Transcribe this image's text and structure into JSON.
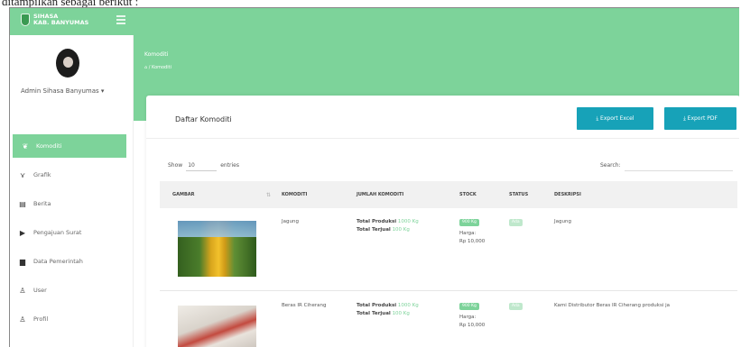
{
  "caption": {
    "text": "ditampilkan sebagai berikut :"
  },
  "brand": {
    "line1": "SIHASA",
    "line2": "KAB. BANYUMAS"
  },
  "sidebar": {
    "user_name": "Admin Sihasa Banyumas ▾",
    "items": [
      {
        "label": "Komoditi",
        "icon": "leaf-icon",
        "glyph": "❦"
      },
      {
        "label": "Grafik",
        "icon": "chart-icon",
        "glyph": "⋎"
      },
      {
        "label": "Berita",
        "icon": "news-icon",
        "glyph": "▤"
      },
      {
        "label": "Pengajuan Surat",
        "icon": "send-icon",
        "glyph": "▶"
      },
      {
        "label": "Data Pemerintah",
        "icon": "database-icon",
        "glyph": "▆"
      },
      {
        "label": "User",
        "icon": "user-icon",
        "glyph": "♙"
      },
      {
        "label": "Profil",
        "icon": "profile-icon",
        "glyph": "♙"
      }
    ]
  },
  "hero": {
    "title": "Komoditi",
    "breadcrumb": "⌂ / Komoditi"
  },
  "card": {
    "title": "Daftar Komoditi",
    "export_excel": "⤓ Export Excel",
    "export_pdf": "⤓ Export PDF",
    "show_label": "Show",
    "show_value": "10",
    "entries_label": "entries",
    "search_label": "Search:"
  },
  "table": {
    "headers": [
      "GAMBAR",
      "KOMODITI",
      "JUMLAH KOMODITI",
      "STOCK",
      "STATUS",
      "DESKRIPSI"
    ],
    "rows": [
      {
        "komoditi": "Jagung",
        "produksi_label": "Total Produksi",
        "produksi_value": "1000 Kg",
        "terjual_label": "Total Terjual",
        "terjual_value": "100 Kg",
        "stock": "900 Kg",
        "harga_label": "Harga:",
        "harga_value": "Rp 10,000",
        "status": "Ada",
        "deskripsi": "Jagung"
      },
      {
        "komoditi": "Beras IR Ciherang",
        "produksi_label": "Total Produksi",
        "produksi_value": "1000 Kg",
        "terjual_label": "Total Terjual",
        "terjual_value": "100 Kg",
        "stock": "900 Kg",
        "harga_label": "Harga:",
        "harga_value": "Rp 10,000",
        "status": "Ada",
        "deskripsi": "Kami Distributor Beras IR Ciherang produksi ja"
      }
    ]
  },
  "colors": {
    "accent": "#7dd39a",
    "button": "#17a2b8"
  }
}
